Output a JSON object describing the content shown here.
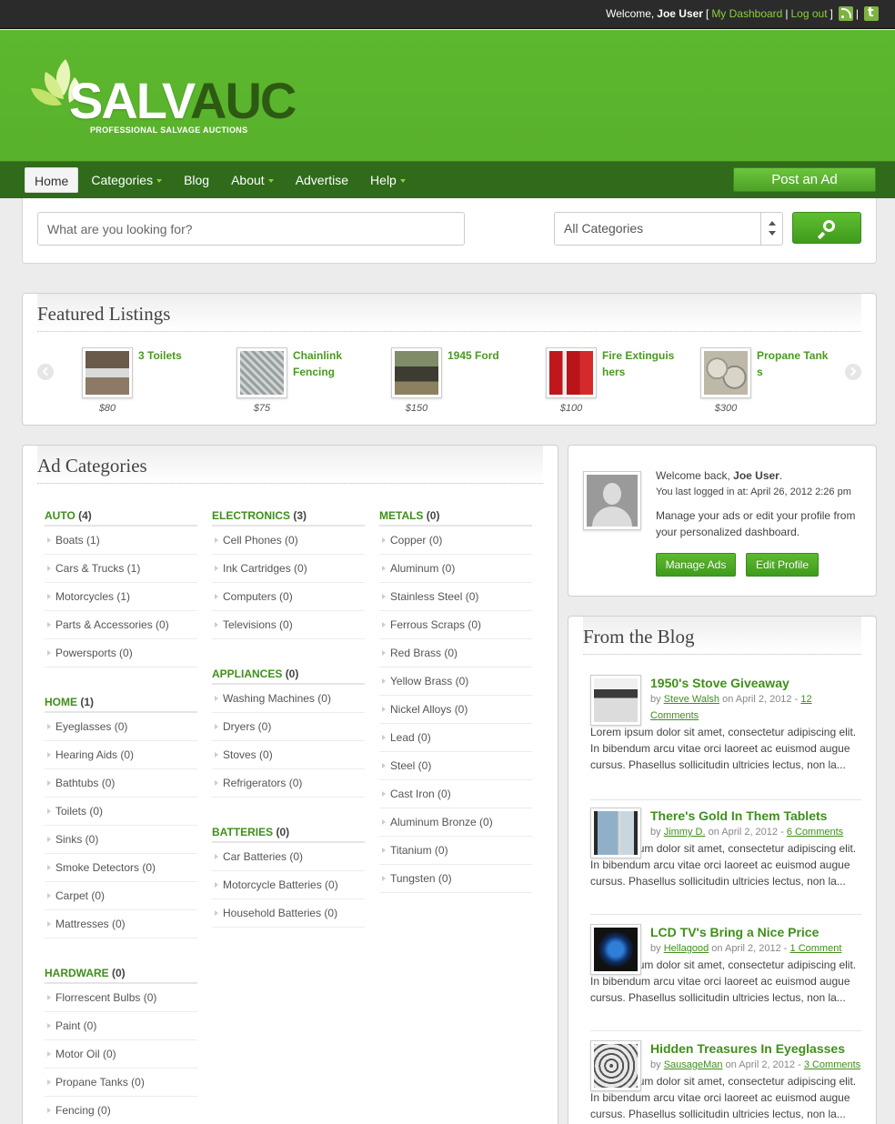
{
  "topbar": {
    "welcome_prefix": "Welcome,",
    "username": "Joe User",
    "bracket_open": "[",
    "dashboard_link": "My Dashboard",
    "separator": "|",
    "logout_link": "Log out",
    "bracket_close": "]",
    "icon_sep": "|",
    "icons": [
      "rss-icon",
      "twitter-icon"
    ]
  },
  "brand": {
    "logo_part1": "SALV",
    "logo_part2": "AUC",
    "tagline": "PROFESSIONAL SALVAGE AUCTIONS",
    "colors": {
      "primary": "#5cb82e",
      "dark": "#2f6b1a",
      "accent": "#3f8f1a"
    }
  },
  "nav": {
    "items": [
      {
        "label": "Home",
        "dropdown": false,
        "active": true
      },
      {
        "label": "Categories",
        "dropdown": true
      },
      {
        "label": "Blog",
        "dropdown": false
      },
      {
        "label": "About",
        "dropdown": true
      },
      {
        "label": "Advertise",
        "dropdown": false
      },
      {
        "label": "Help",
        "dropdown": true
      }
    ],
    "post_ad": "Post an Ad"
  },
  "search": {
    "placeholder": "What are you looking for?",
    "category_selected": "All Categories",
    "button_icon": "search-icon"
  },
  "featured": {
    "title": "Featured Listings",
    "items": [
      {
        "title": "3 Toilets",
        "price": "$80"
      },
      {
        "title": "Chainlink Fencing",
        "price": "$75"
      },
      {
        "title": "1945 Ford",
        "price": "$150"
      },
      {
        "title": "Fire Extinguishers",
        "price": "$100"
      },
      {
        "title": "Propane Tanks",
        "price": "$300"
      }
    ]
  },
  "ad_categories": {
    "title": "Ad Categories",
    "columns": [
      [
        {
          "name": "AUTO",
          "count": "(4)",
          "items": [
            "Boats (1)",
            "Cars & Trucks (1)",
            "Motorcycles (1)",
            "Parts & Accessories (0)",
            "Powersports (0)"
          ]
        },
        {
          "name": "HOME",
          "count": "(1)",
          "items": [
            "Eyeglasses (0)",
            "Hearing Aids (0)",
            "Bathtubs (0)",
            "Toilets (0)",
            "Sinks (0)",
            "Smoke Detectors (0)",
            "Carpet (0)",
            "Mattresses (0)"
          ]
        },
        {
          "name": "HARDWARE",
          "count": "(0)",
          "items": [
            "Florrescent Bulbs (0)",
            "Paint (0)",
            "Motor Oil (0)",
            "Propane Tanks (0)",
            "Fencing (0)"
          ]
        }
      ],
      [
        {
          "name": "ELECTRONICS",
          "count": "(3)",
          "items": [
            "Cell Phones (0)",
            "Ink Cartridges (0)",
            "Computers (0)",
            "Televisions (0)"
          ]
        },
        {
          "name": "APPLIANCES",
          "count": "(0)",
          "items": [
            "Washing Machines (0)",
            "Dryers (0)",
            "Stoves (0)",
            "Refrigerators (0)"
          ]
        },
        {
          "name": "BATTERIES",
          "count": "(0)",
          "items": [
            "Car Batteries (0)",
            "Motorcycle Batteries (0)",
            "Household Batteries (0)"
          ]
        }
      ],
      [
        {
          "name": "METALS",
          "count": "(0)",
          "items": [
            "Copper (0)",
            "Aluminum (0)",
            "Stainless Steel (0)",
            "Ferrous Scraps (0)",
            "Red Brass (0)",
            "Yellow Brass (0)",
            "Nickel Alloys (0)",
            "Lead (0)",
            "Steel (0)",
            "Cast Iron (0)",
            "Aluminum Bronze (0)",
            "Titanium (0)",
            "Tungsten (0)"
          ]
        }
      ]
    ]
  },
  "welcome_box": {
    "greeting": "Welcome back,",
    "username": "Joe User",
    "period": ".",
    "last_login": "You last logged in at: April 26, 2012 2:26 pm",
    "message": "Manage your ads or edit your profile from your personalized dashboard.",
    "manage_ads": "Manage Ads",
    "edit_profile": "Edit Profile"
  },
  "blog": {
    "title": "From the Blog",
    "posts": [
      {
        "title": "1950's Stove Giveaway",
        "by": "by",
        "author": "Steve Walsh",
        "on": "on April 2, 2012 -",
        "comments": "12 Comments",
        "excerpt": "Lorem ipsum dolor sit amet, consectetur adipiscing elit. In bibendum arcu vitae orci laoreet ac euismod augue cursus. Phasellus sollicitudin ultricies lectus, non la..."
      },
      {
        "title": "There's Gold In Them Tablets",
        "by": "by",
        "author": "Jimmy D.",
        "on": "on April 2, 2012 -",
        "comments": "6 Comments",
        "excerpt": "Lorem ipsum dolor sit amet, consectetur adipiscing elit. In bibendum arcu vitae orci laoreet ac euismod augue cursus. Phasellus sollicitudin ultricies lectus, non la..."
      },
      {
        "title": "LCD TV's Bring a Nice Price",
        "by": "by",
        "author": "Hellagood",
        "on": "on April 2, 2012 -",
        "comments": "1 Comment",
        "excerpt": "Lorem ipsum dolor sit amet, consectetur adipiscing elit. In bibendum arcu vitae orci laoreet ac euismod augue cursus. Phasellus sollicitudin ultricies lectus, non la..."
      },
      {
        "title": "Hidden Treasures In Eyeglasses",
        "by": "by",
        "author": "SausageMan",
        "on": "on April 2, 2012 -",
        "comments": "3 Comments",
        "excerpt": "Lorem ipsum dolor sit amet, consectetur adipiscing elit. In bibendum arcu vitae orci laoreet ac euismod augue cursus. Phasellus sollicitudin ultricies lectus, non la..."
      }
    ]
  }
}
